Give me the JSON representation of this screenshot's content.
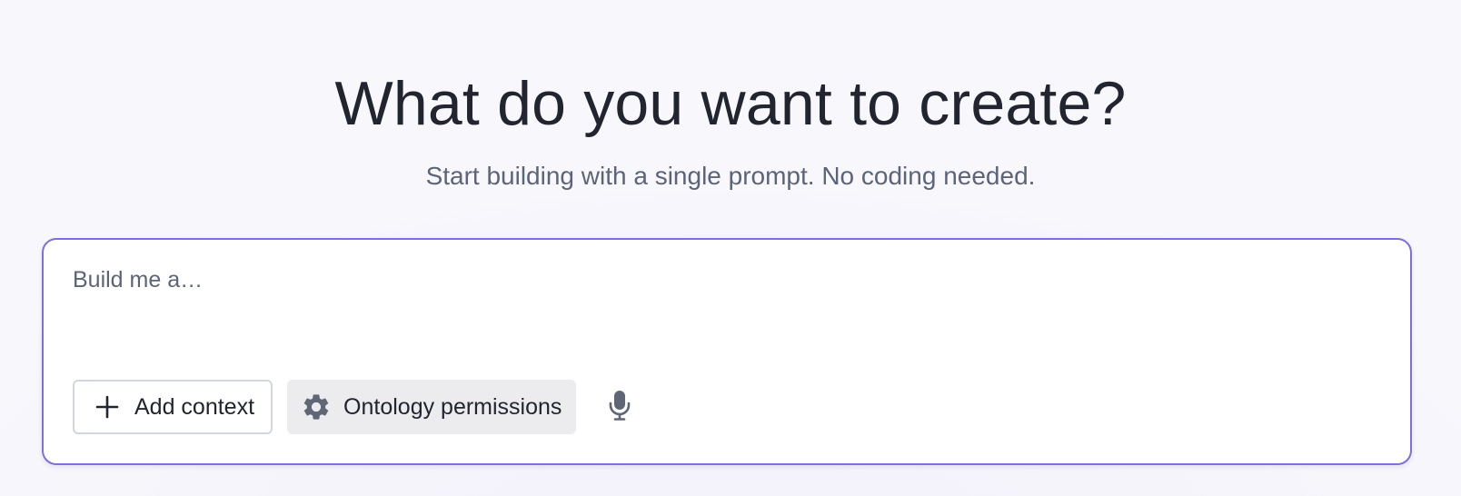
{
  "header": {
    "title": "What do you want to create?",
    "subtitle": "Start building with a single prompt. No coding needed."
  },
  "prompt": {
    "placeholder": "Build me a…",
    "value": ""
  },
  "actions": {
    "add_context_label": "Add context",
    "add_context_icon": "plus-icon",
    "ontology_label": "Ontology permissions",
    "ontology_icon": "gear-icon",
    "mic_icon": "microphone-icon"
  },
  "colors": {
    "accent_border": "#7f6ee0",
    "title_text": "#22252f",
    "muted_text": "#5c6477",
    "icon_gray": "#5f6676"
  }
}
